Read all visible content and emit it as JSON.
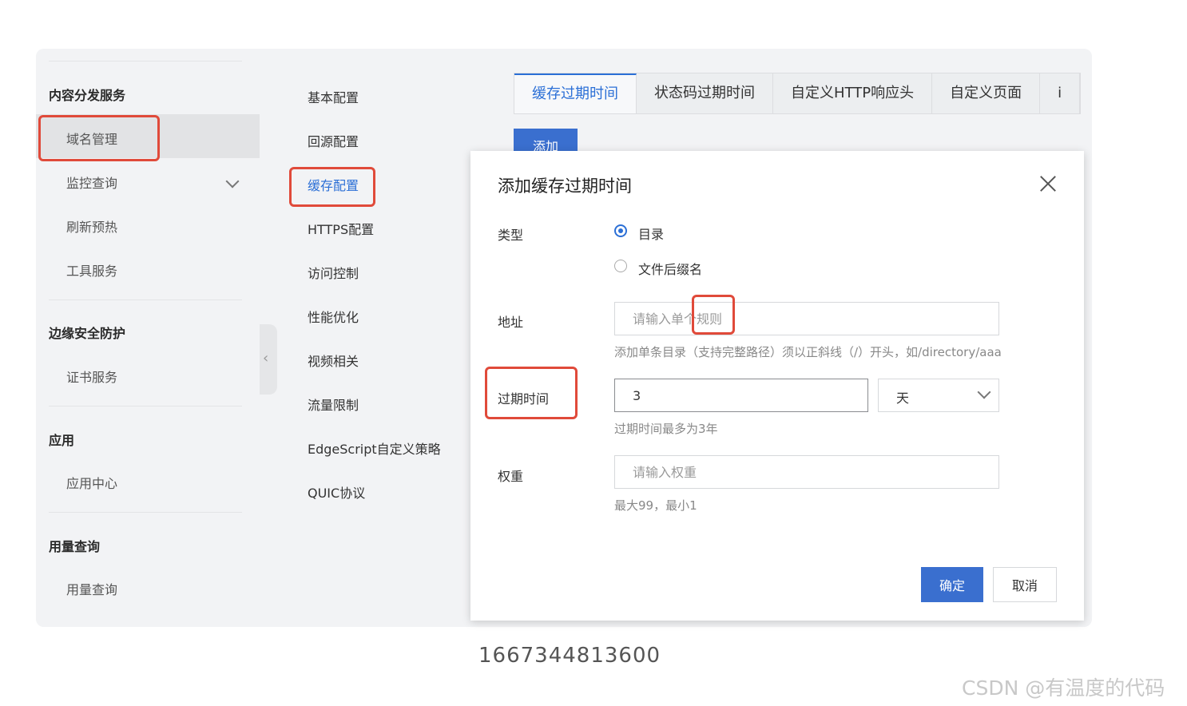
{
  "sidebar": {
    "groups": [
      {
        "label": "内容分发服务"
      },
      {
        "label": "边缘安全防护"
      },
      {
        "label": "应用"
      },
      {
        "label": "用量查询"
      }
    ],
    "items": [
      {
        "label": "域名管理"
      },
      {
        "label": "监控查询"
      },
      {
        "label": "刷新预热"
      },
      {
        "label": "工具服务"
      },
      {
        "label": "证书服务"
      },
      {
        "label": "应用中心"
      },
      {
        "label": "用量查询"
      }
    ],
    "collapse_icon": "chevron-left-icon"
  },
  "subnav": {
    "items": [
      {
        "label": "基本配置"
      },
      {
        "label": "回源配置"
      },
      {
        "label": "缓存配置"
      },
      {
        "label": "HTTPS配置"
      },
      {
        "label": "访问控制"
      },
      {
        "label": "性能优化"
      },
      {
        "label": "视频相关"
      },
      {
        "label": "流量限制"
      },
      {
        "label": "EdgeScript自定义策略"
      },
      {
        "label": "QUIC协议"
      }
    ]
  },
  "tabs": [
    {
      "label": "缓存过期时间"
    },
    {
      "label": "状态码过期时间"
    },
    {
      "label": "自定义HTTP响应头"
    },
    {
      "label": "自定义页面"
    },
    {
      "label": "i"
    }
  ],
  "main": {
    "add_label": "添加"
  },
  "modal": {
    "title": "添加缓存过期时间",
    "type_label": "类型",
    "type_options": [
      {
        "label": "目录"
      },
      {
        "label": "文件后缀名"
      }
    ],
    "address_label": "地址",
    "address_placeholder": "请输入单个规则",
    "address_hint": "添加单条目录（支持完整路径）须以正斜线（/）开头，如/directory/aaa",
    "expire_label": "过期时间",
    "expire_value": "3",
    "expire_unit": "天",
    "expire_hint": "过期时间最多为3年",
    "weight_label": "权重",
    "weight_placeholder": "请输入权重",
    "weight_hint": "最大99，最小1",
    "ok_label": "确定",
    "cancel_label": "取消"
  },
  "caption": "1667344813600",
  "watermark": "CSDN @有温度的代码",
  "colors": {
    "accent": "#2b6fd6",
    "highlight": "#e04a3a",
    "primary_button": "#3a6fcf"
  }
}
